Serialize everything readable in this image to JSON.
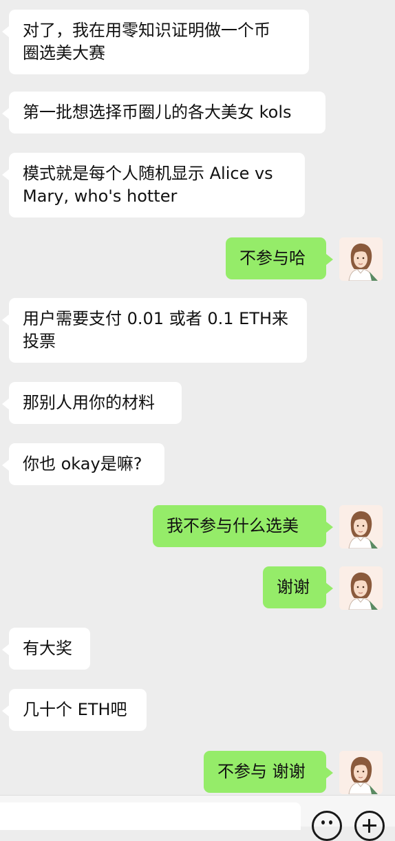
{
  "messages": [
    {
      "side": "in",
      "text": "对了，我在用零知识证明做一个币\n圈选美大赛"
    },
    {
      "side": "in",
      "text": "第一批想选择币圈儿的各大美女 kols"
    },
    {
      "side": "in",
      "text": "模式就是每个人随机显示 Alice vs\nMary, who's hotter"
    },
    {
      "side": "out",
      "text": "不参与哈"
    },
    {
      "side": "in",
      "text": "用户需要支付 0.01 或者 0.1 ETH来\n投票"
    },
    {
      "side": "in",
      "text": "那别人用你的材料"
    },
    {
      "side": "in",
      "text": "你也 okay是嘛?"
    },
    {
      "side": "out",
      "text": "我不参与什么选美"
    },
    {
      "side": "out",
      "text": "谢谢"
    },
    {
      "side": "in",
      "text": "有大奖"
    },
    {
      "side": "in",
      "text": "几十个 ETH吧"
    },
    {
      "side": "out",
      "text": "不参与 谢谢"
    }
  ],
  "avatar_icon": "user-avatar-illustrated-woman",
  "input_bar": {
    "emoji_icon": "emoji-face-icon",
    "plus_icon": "plus-circle-icon"
  },
  "colors": {
    "background": "#ededed",
    "incoming_bubble": "#ffffff",
    "outgoing_bubble": "#95ec69",
    "text": "#111111"
  }
}
